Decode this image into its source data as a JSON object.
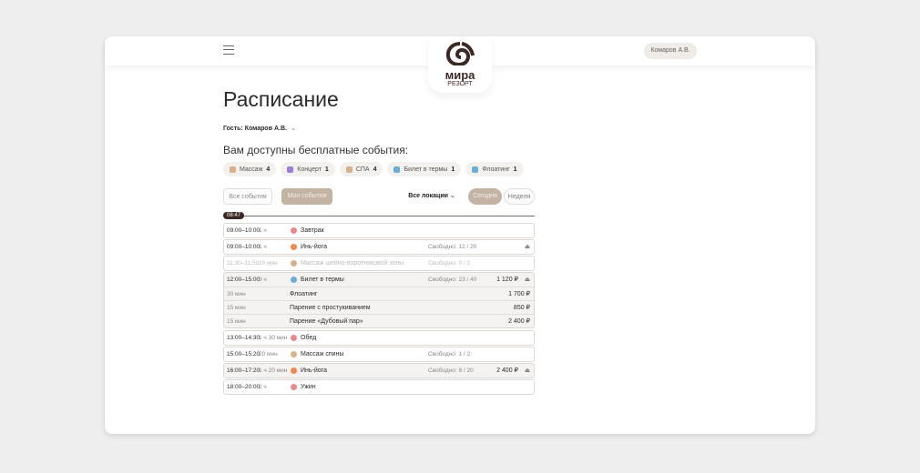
{
  "header": {
    "user": "Комаров А.В.",
    "logo_main": "мира",
    "logo_sub": "РЕЗОРТ"
  },
  "page": {
    "title": "Расписание",
    "guest": "Гость: Комаров А.В.",
    "free_title": "Вам доступны бесплатные события:"
  },
  "chips": [
    {
      "label": "Массаж",
      "count": "4",
      "icon": "massage-icon",
      "color": "#d9b08c"
    },
    {
      "label": "Концерт",
      "count": "1",
      "icon": "music-note-icon",
      "color": "#9b7fd6"
    },
    {
      "label": "СПА",
      "count": "4",
      "icon": "massage-icon",
      "color": "#d9b08c"
    },
    {
      "label": "Билет в термы",
      "count": "1",
      "icon": "pool-icon",
      "color": "#6aaed6"
    },
    {
      "label": "Флоатинг",
      "count": "1",
      "icon": "pool-icon",
      "color": "#6aaed6"
    }
  ],
  "filters": {
    "all": "Все события",
    "mine": "Мои события",
    "locations": "Все локации",
    "today": "Сегодня",
    "week": "Неделя"
  },
  "now": "08:47",
  "rows": [
    {
      "time": "09:00–10:00",
      "dur": "1 ч",
      "name": "Завтрак",
      "free": "",
      "price": "",
      "icon": "food-icon",
      "color": "#e88a8a"
    },
    {
      "time": "09:00–10:00",
      "dur": "1 ч",
      "name": "Инь-йога",
      "free": "Свободно: 12 / 20",
      "price": "",
      "icon": "yoga-icon",
      "color": "#f08a4b"
    },
    {
      "time": "11:30–11:50",
      "dur": "20 мин",
      "name": "Массаж шейно-воротниковой зоны",
      "free": "Свободно: 0 / 2",
      "price": "",
      "icon": "massage-icon",
      "color": "#d9b08c"
    },
    {
      "time": "12:00–15:00",
      "dur": "3 ч",
      "name": "Билет в термы",
      "free": "Свободно: 23 / 40",
      "price": "1 120 ₽",
      "icon": "pool-icon",
      "color": "#6aaed6",
      "subs": [
        {
          "dur": "30 мин",
          "name": "Флоатинг",
          "price": "1 700 ₽"
        },
        {
          "dur": "15 мин",
          "name": "Парение с простукиванием",
          "price": "850 ₽"
        },
        {
          "dur": "15 мин",
          "name": "Парение «Дубовый пар»",
          "price": "2 400 ₽"
        }
      ]
    },
    {
      "time": "13:00–14:30",
      "dur": "1 ч 30 мин",
      "name": "Обед",
      "free": "",
      "price": "",
      "icon": "food-icon",
      "color": "#e88a8a"
    },
    {
      "time": "15:00–15:20",
      "dur": "20 мин",
      "name": "Массаж спины",
      "free": "Свободно: 1 / 2",
      "price": "",
      "icon": "massage-icon",
      "color": "#d9b08c"
    },
    {
      "time": "16:00–17:20",
      "dur": "1 ч 20 мин",
      "name": "Инь-йога",
      "free": "Свободно: 8 / 20",
      "price": "2 400 ₽",
      "icon": "yoga-icon",
      "color": "#f08a4b"
    },
    {
      "time": "18:00–20:00",
      "dur": "2 ч",
      "name": "Ужин",
      "free": "",
      "price": "",
      "icon": "food-icon",
      "color": "#e88a8a"
    }
  ]
}
